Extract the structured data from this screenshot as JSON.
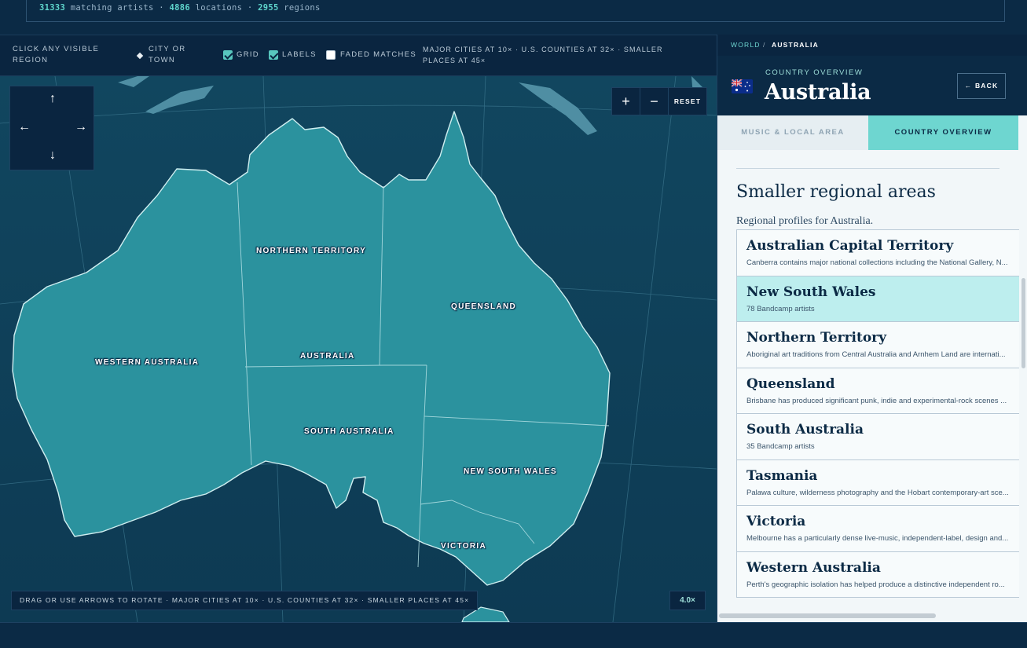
{
  "stats": {
    "artists": "31333",
    "artists_label": "matching artists ·",
    "locations": "4886",
    "locations_label": "locations ·",
    "regions": "2955",
    "regions_label": "regions"
  },
  "controls": {
    "click_hint": "CLICK ANY VISIBLE REGION",
    "city_label": "CITY OR TOWN",
    "grid": {
      "label": "GRID",
      "checked": true
    },
    "labels": {
      "label": "LABELS",
      "checked": true
    },
    "faded": {
      "label": "FADED MATCHES",
      "checked": false
    },
    "scale_note": "MAJOR CITIES AT 10× · U.S. COUNTIES AT 32× · SMALLER PLACES AT 45×"
  },
  "map": {
    "region_labels": [
      "NORTHERN TERRITORY",
      "QUEENSLAND",
      "WESTERN AUSTRALIA",
      "AUSTRALIA",
      "SOUTH AUSTRALIA",
      "NEW SOUTH WALES",
      "VICTORIA"
    ],
    "arrows": {
      "up": "↑",
      "left": "←",
      "right": "→",
      "down": "↓"
    },
    "zoom_in": "+",
    "zoom_out": "−",
    "reset": "RESET",
    "hint": "DRAG OR USE ARROWS TO ROTATE · MAJOR CITIES AT 10× · U.S. COUNTIES AT 32× · SMALLER PLACES AT 45×",
    "zoom_level": "4.0×",
    "colors": {
      "land": "#2b929e",
      "ocean": "#11465f",
      "border": "#cfeef0"
    }
  },
  "panel": {
    "breadcrumb": {
      "world": "WORLD",
      "sep": "/",
      "current": "AUSTRALIA"
    },
    "subtitle": "COUNTRY OVERVIEW",
    "title": "Australia",
    "back": "← BACK",
    "tabs": [
      "MUSIC & LOCAL AREA",
      "COUNTRY OVERVIEW"
    ],
    "section_title": "Smaller regional areas",
    "section_sub": "Regional profiles for Australia.",
    "regions": [
      {
        "name": "Australian Capital Territory",
        "desc": "Canberra contains major national collections including the National Gallery, N..."
      },
      {
        "name": "New South Wales",
        "desc": "78 Bandcamp artists"
      },
      {
        "name": "Northern Territory",
        "desc": "Aboriginal art traditions from Central Australia and Arnhem Land are internati..."
      },
      {
        "name": "Queensland",
        "desc": "Brisbane has produced significant punk, indie and experimental-rock scenes ..."
      },
      {
        "name": "South Australia",
        "desc": "35 Bandcamp artists"
      },
      {
        "name": "Tasmania",
        "desc": "Palawa culture, wilderness photography and the Hobart contemporary-art sce..."
      },
      {
        "name": "Victoria",
        "desc": "Melbourne has a particularly dense live-music, independent-label, design and..."
      },
      {
        "name": "Western Australia",
        "desc": "Perth's geographic isolation has helped produce a distinctive independent ro..."
      }
    ]
  }
}
